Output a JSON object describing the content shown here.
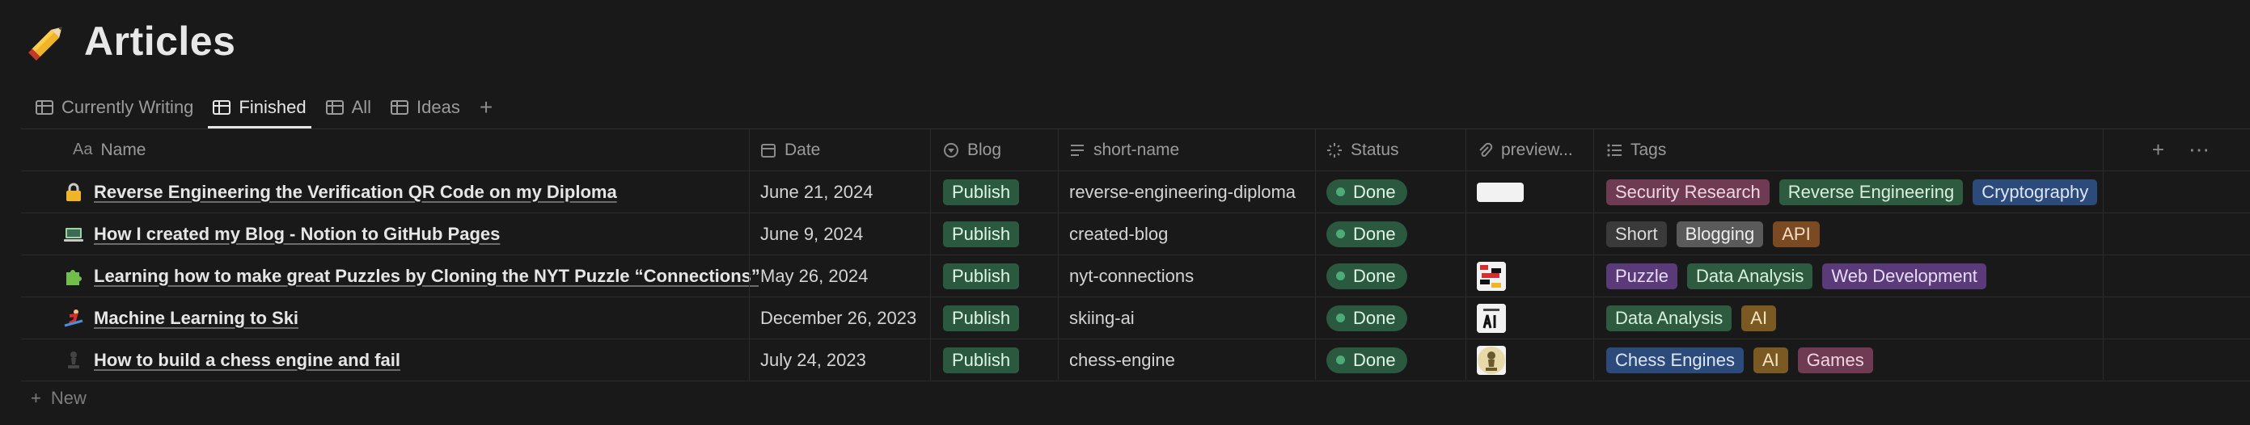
{
  "page": {
    "title": "Articles",
    "title_icon": "pencil-emoji"
  },
  "tabs": [
    {
      "label": "Currently Writing",
      "icon": "table-icon"
    },
    {
      "label": "Finished",
      "icon": "table-icon",
      "active": true
    },
    {
      "label": "All",
      "icon": "table-icon"
    },
    {
      "label": "Ideas",
      "icon": "table-icon"
    }
  ],
  "columns": {
    "name": "Name",
    "name_prefix": "Aa",
    "date": "Date",
    "blog": "Blog",
    "short_name": "short-name",
    "status": "Status",
    "preview": "preview...",
    "tags": "Tags"
  },
  "rows": [
    {
      "icon": "lock-emoji",
      "name": "Reverse Engineering the Verification QR Code on my Diploma",
      "date": "June 21, 2024",
      "blog": "Publish",
      "short_name": "reverse-engineering-diploma",
      "status": "Done",
      "tags": [
        {
          "label": "Security Research",
          "color": "#6e3b52"
        },
        {
          "label": "Reverse Engineering",
          "color": "#2e5a3f"
        },
        {
          "label": "Cryptography",
          "color": "#2c4a7a"
        }
      ]
    },
    {
      "icon": "laptop-emoji",
      "name": "How I created my Blog - Notion to GitHub Pages",
      "date": "June 9, 2024",
      "blog": "Publish",
      "short_name": "created-blog",
      "status": "Done",
      "tags": [
        {
          "label": "Short",
          "color": "#3a3a3a"
        },
        {
          "label": "Blogging",
          "color": "#5a5a5a"
        },
        {
          "label": "API",
          "color": "#7a4a22"
        }
      ]
    },
    {
      "icon": "puzzle-emoji",
      "name": "Learning how to make great Puzzles by Cloning the NYT Puzzle “Connections”",
      "date": "May 26, 2024",
      "blog": "Publish",
      "short_name": "nyt-connections",
      "status": "Done",
      "tags": [
        {
          "label": "Puzzle",
          "color": "#5a3a78"
        },
        {
          "label": "Data Analysis",
          "color": "#2e5a3f"
        },
        {
          "label": "Web Development",
          "color": "#5a3a78"
        }
      ]
    },
    {
      "icon": "ski-emoji",
      "name": "Machine Learning to Ski",
      "date": "December 26, 2023",
      "blog": "Publish",
      "short_name": "skiing-ai",
      "status": "Done",
      "tags": [
        {
          "label": "Data Analysis",
          "color": "#2e5a3f"
        },
        {
          "label": "AI",
          "color": "#7a5a22"
        }
      ]
    },
    {
      "icon": "chess-pawn-emoji",
      "name": "How to build a chess engine and fail",
      "date": "July 24, 2023",
      "blog": "Publish",
      "short_name": "chess-engine",
      "status": "Done",
      "tags": [
        {
          "label": "Chess Engines",
          "color": "#2c4a7a"
        },
        {
          "label": "AI",
          "color": "#7a5a22"
        },
        {
          "label": "Games",
          "color": "#6e3b52"
        }
      ]
    }
  ],
  "new_row_label": "New"
}
